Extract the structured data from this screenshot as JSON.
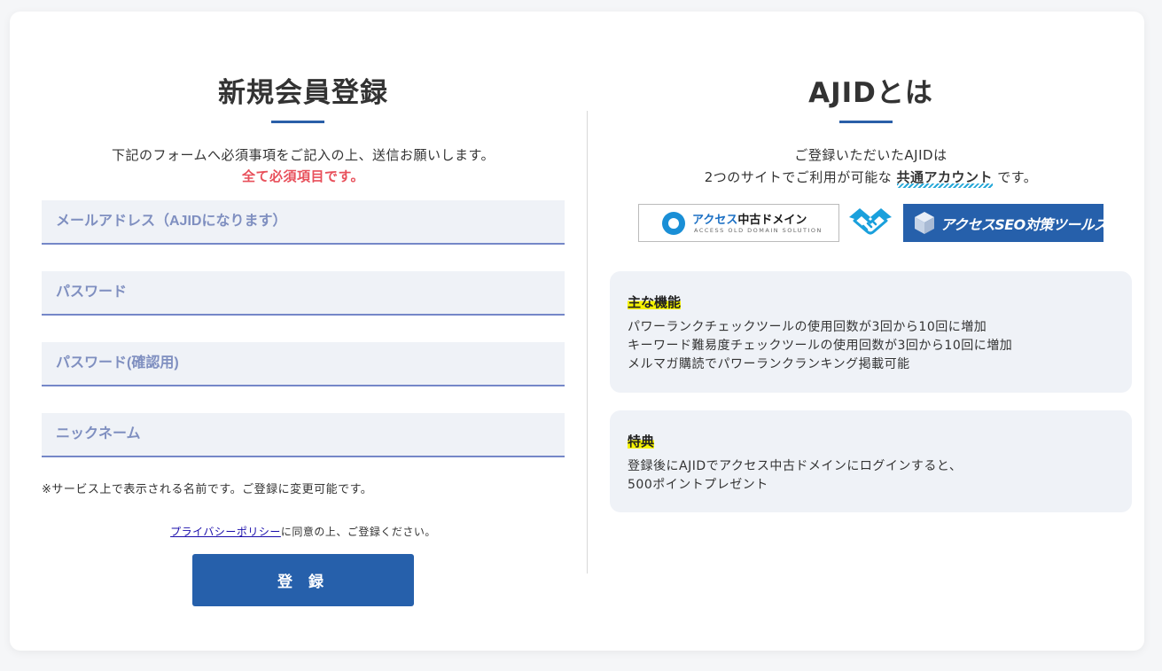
{
  "register": {
    "title": "新規会員登録",
    "intro": "下記のフォームへ必須事項をご記入の上、送信お願いします。",
    "required_note": "全て必須項目です。",
    "fields": {
      "email_placeholder": "メールアドレス（AJIDになります）",
      "password_placeholder": "パスワード",
      "password_confirm_placeholder": "パスワード(確認用)",
      "nickname_placeholder": "ニックネーム"
    },
    "nickname_note": "※サービス上で表示される名前です。ご登録に変更可能です。",
    "policy_link": "プライバシーポリシー",
    "policy_text": "に同意の上、ご登録ください。",
    "submit_label": "登 録"
  },
  "ajid": {
    "title": "AJIDとは",
    "intro_line1": "ご登録いただいたAJIDは",
    "intro_line2_before": "2つのサイトでご利用が可能な ",
    "intro_highlight": "共通アカウント",
    "intro_line2_after": " です。",
    "logos": {
      "aod_name_blue": "アクセス",
      "aod_name_black": "中古ドメイン",
      "aod_sub": "ACCESS OLD DOMAIN SOLUTION",
      "seo_name": "アクセスSEO対策ツールズ",
      "handshake_icon": "handshake-icon"
    },
    "features": {
      "title": "主な機能",
      "items": [
        "パワーランクチェックツールの使用回数が3回から10回に増加",
        "キーワード難易度チェックツールの使用回数が3回から10回に増加",
        "メルマガ購読でパワーランクランキング掲載可能"
      ]
    },
    "perks": {
      "title": "特典",
      "items": [
        "登録後にAJIDでアクセス中古ドメインにログインすると、",
        "500ポイントプレゼント"
      ]
    }
  },
  "colors": {
    "accent": "#2660ab",
    "required": "#e8505b",
    "highlight": "#f5f300",
    "field_bg": "#eff2f7",
    "field_border": "#7587c8"
  }
}
